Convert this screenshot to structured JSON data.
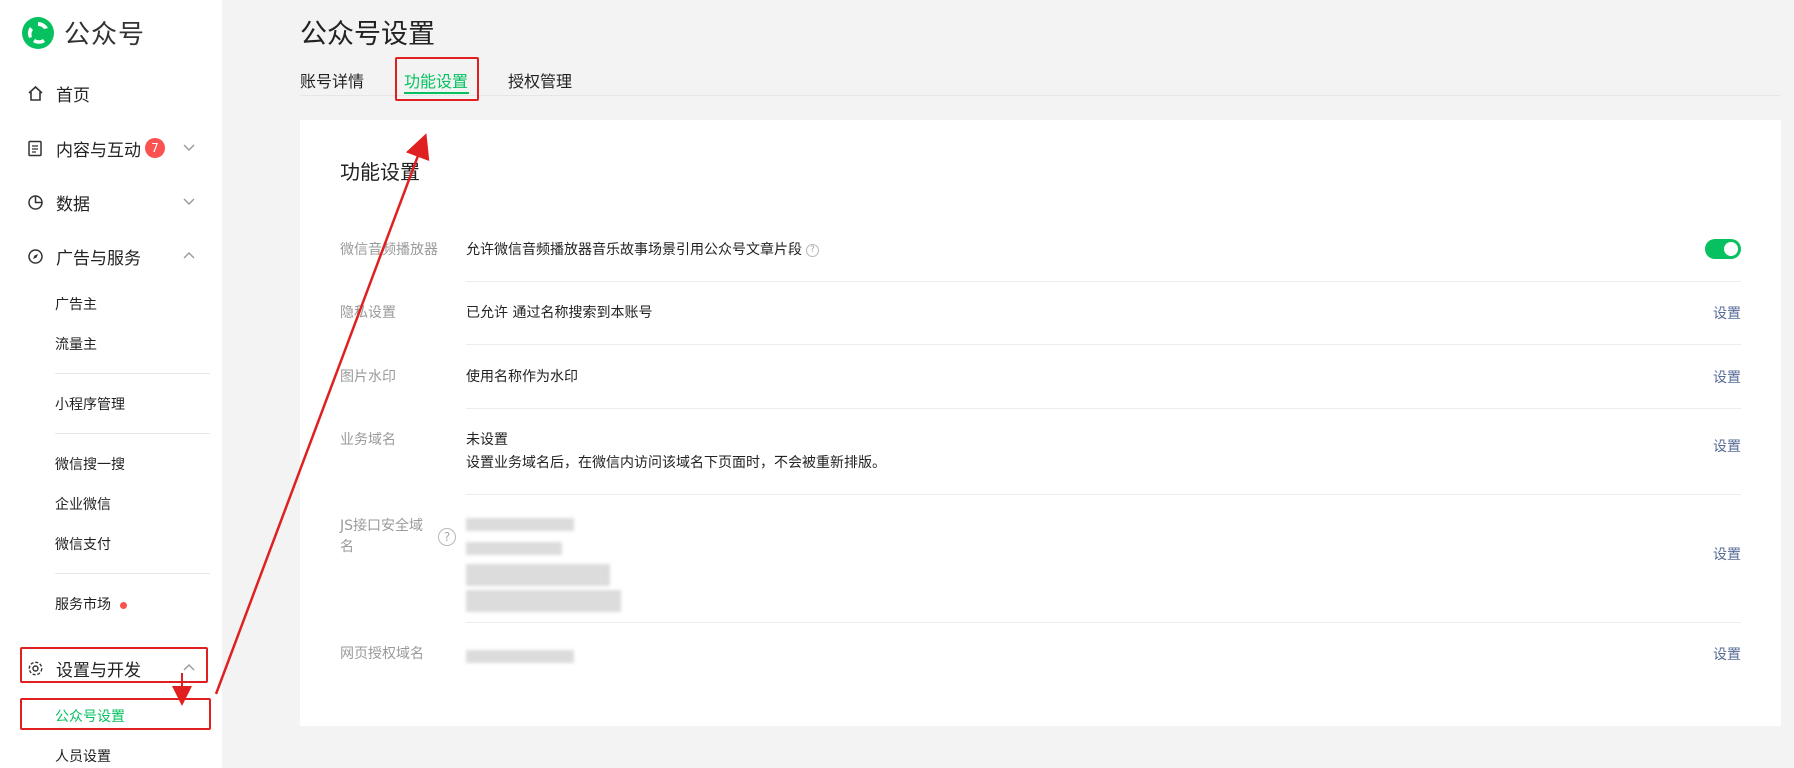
{
  "app": {
    "name": "公众号"
  },
  "sidebar": {
    "home": "首页",
    "content": {
      "label": "内容与互动",
      "badge": "7"
    },
    "data": "数据",
    "ads": {
      "label": "广告与服务",
      "items": [
        "广告主",
        "流量主",
        "小程序管理",
        "微信搜一搜",
        "企业微信",
        "微信支付",
        "服务市场"
      ]
    },
    "settings": {
      "label": "设置与开发",
      "items": [
        "公众号设置",
        "人员设置"
      ]
    }
  },
  "page": {
    "title": "公众号设置",
    "tabs": [
      "账号详情",
      "功能设置",
      "授权管理"
    ],
    "active_tab": "功能设置"
  },
  "card": {
    "title": "功能设置",
    "rows": [
      {
        "label": "微信音频播放器",
        "value": "允许微信音频播放器音乐故事场景引用公众号文章片段",
        "toggle_on": true
      },
      {
        "label": "隐私设置",
        "value": "已允许 通过名称搜索到本账号",
        "action": "设置"
      },
      {
        "label": "图片水印",
        "value": "使用名称作为水印",
        "action": "设置"
      },
      {
        "label": "业务域名",
        "value": "未设置",
        "sub": "设置业务域名后，在微信内访问该域名下页面时，不会被重新排版。",
        "action": "设置"
      },
      {
        "label": "JS接口安全域名",
        "action": "设置"
      },
      {
        "label": "网页授权域名",
        "action": "设置"
      }
    ]
  },
  "colors": {
    "accent": "#07c160",
    "link": "#576b95",
    "badge": "#fa5151",
    "highlight": "#e02020"
  }
}
